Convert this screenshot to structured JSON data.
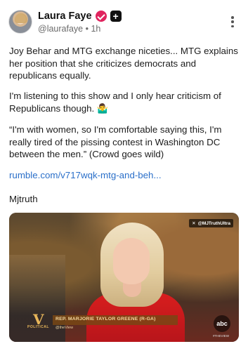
{
  "post": {
    "author_name": "Laura Faye",
    "handle": "@laurafaye",
    "separator": "•",
    "time_ago": "1h",
    "plus_badge": "+",
    "paragraph1": "Joy Behar and MTG exchange niceties... MTG explains her position that she criticizes democrats and republicans equally.",
    "paragraph2": "I'm listening to this show and I only hear criticism of Republicans though. 🤷‍♂️",
    "paragraph3": "“I'm with women, so I'm comfortable saying this, I'm really tired of the pissing contest in Washington DC between the men.” (Crowd goes wild)",
    "link_text": "rumble.com/v717wqk-mtg-and-beh...",
    "signature": "Mjtruth"
  },
  "video": {
    "watermark": "@MJTruthUltra",
    "chyron_name": "REP. MARJORIE TAYLOR GREENE (R-GA)",
    "chyron_sub": "@theView",
    "show_logo_letter": "V",
    "show_logo_label": "POLITICAL",
    "network_logo": "abc",
    "network_sub": "#THEVIEW"
  },
  "icons": {
    "verified": "verified-badge-icon",
    "more": "more-options-icon",
    "x_logo": "x-logo-icon"
  },
  "colors": {
    "verified": "#e0245e",
    "link": "#2a6fc9",
    "dress": "#d81e1e"
  }
}
